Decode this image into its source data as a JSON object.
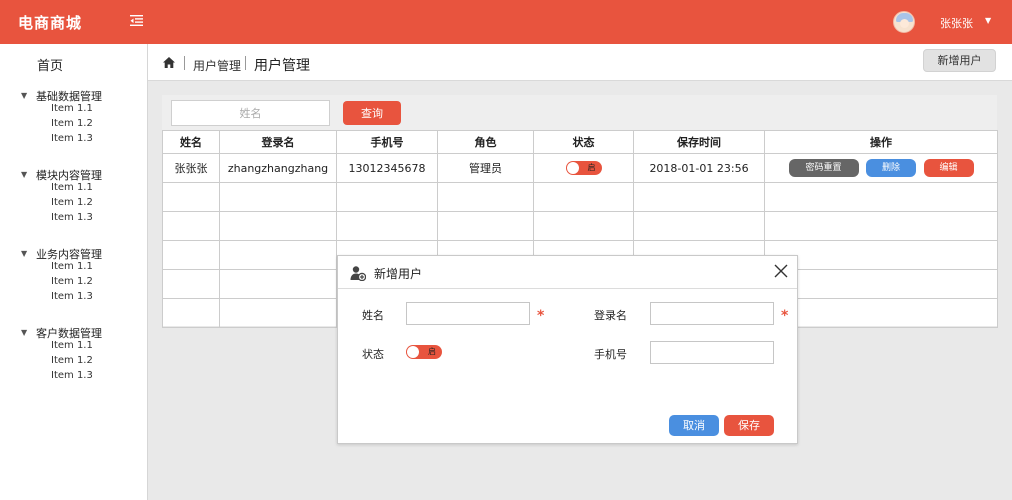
{
  "header": {
    "brand": "电商商城",
    "username": "张张张",
    "menu_icon": "menu-collapse-icon",
    "user_caret": "▼",
    "brand_color": "#e8543e"
  },
  "sidebar": {
    "home": "首页",
    "groups": [
      {
        "title": "基础数据管理",
        "items": [
          "Item 1.1",
          "Item 1.2",
          "Item 1.3"
        ]
      },
      {
        "title": "模块内容管理",
        "items": [
          "Item 1.1",
          "Item 1.2",
          "Item 1.3"
        ]
      },
      {
        "title": "业务内容管理",
        "items": [
          "Item 1.1",
          "Item 1.2",
          "Item 1.3"
        ]
      },
      {
        "title": "客户数据管理",
        "items": [
          "Item 1.1",
          "Item 1.2",
          "Item 1.3"
        ]
      }
    ]
  },
  "breadcrumb": {
    "section": "用户管理",
    "current": "用户管理"
  },
  "toolbar": {
    "add_user_label": "新增用户"
  },
  "search": {
    "placeholder": "姓名",
    "query_label": "查询"
  },
  "table": {
    "columns": [
      "姓名",
      "登录名",
      "手机号",
      "角色",
      "状态",
      "保存时间",
      "操作"
    ],
    "rows": [
      {
        "name": "张张张",
        "login": "zhangzhangzhang",
        "phone": "13012345678",
        "role": "管理员",
        "status": "启",
        "saved": "2018-01-01 23:56",
        "actions": {
          "reset": "密码重置",
          "delete": "删除",
          "edit": "编辑"
        }
      }
    ],
    "empty_rows": 5
  },
  "modal": {
    "title": "新增用户",
    "name_label": "姓名",
    "login_label": "登录名",
    "status_label": "状态",
    "phone_label": "手机号",
    "status_value": "启",
    "required_mark": "*",
    "cancel_label": "取消",
    "save_label": "保存"
  },
  "colors": {
    "accent": "#e8543e",
    "blue": "#4a8fe0",
    "gray_button": "#666666"
  }
}
